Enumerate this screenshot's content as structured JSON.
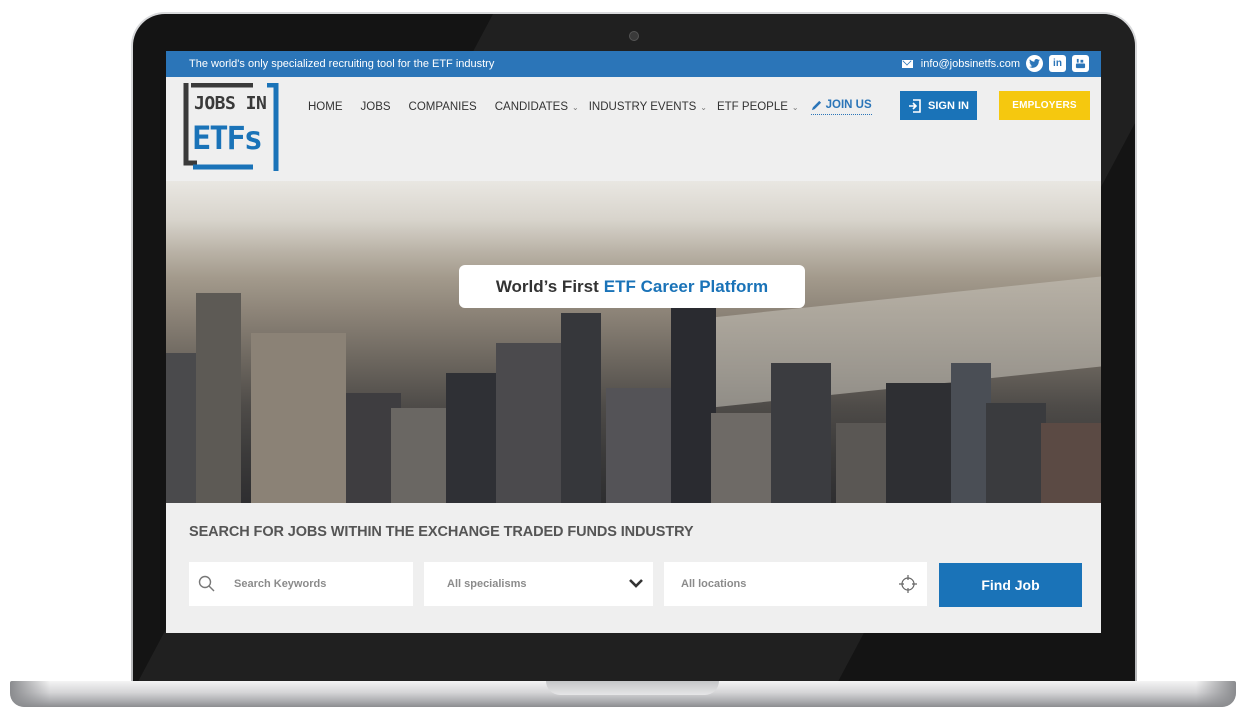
{
  "topbar": {
    "tagline": "The world's only specialized recruiting tool for the ETF industry",
    "email": "info@jobsinetfs.com",
    "social_icons": [
      "twitter-icon",
      "linkedin-icon",
      "youtube-icon"
    ]
  },
  "logo": {
    "line1": "JOBS IN",
    "line2": "ETFs"
  },
  "nav": {
    "items": [
      {
        "label": "HOME"
      },
      {
        "label": "JOBS"
      },
      {
        "label": "COMPANIES"
      },
      {
        "label": "CANDIDATES",
        "has_dropdown": true
      },
      {
        "label": "INDUSTRY EVENTS",
        "has_dropdown": true
      },
      {
        "label": "ETF PEOPLE",
        "has_dropdown": true
      }
    ],
    "join_label": "JOIN US",
    "signin_label": "SIGN IN",
    "employers_label": "EMPLOYERS"
  },
  "hero": {
    "title_prefix": "World’s First",
    "title_accent": "ETF Career Platform"
  },
  "search": {
    "heading": "SEARCH FOR JOBS WITHIN THE EXCHANGE TRADED FUNDS INDUSTRY",
    "keywords_placeholder": "Search Keywords",
    "specialisms_value": "All specialisms",
    "locations_value": "All locations",
    "button_label": "Find Job"
  },
  "colors": {
    "brand_blue": "#1a73b8",
    "topbar_blue": "#2b75b8",
    "employers_yellow": "#f5c80f"
  }
}
